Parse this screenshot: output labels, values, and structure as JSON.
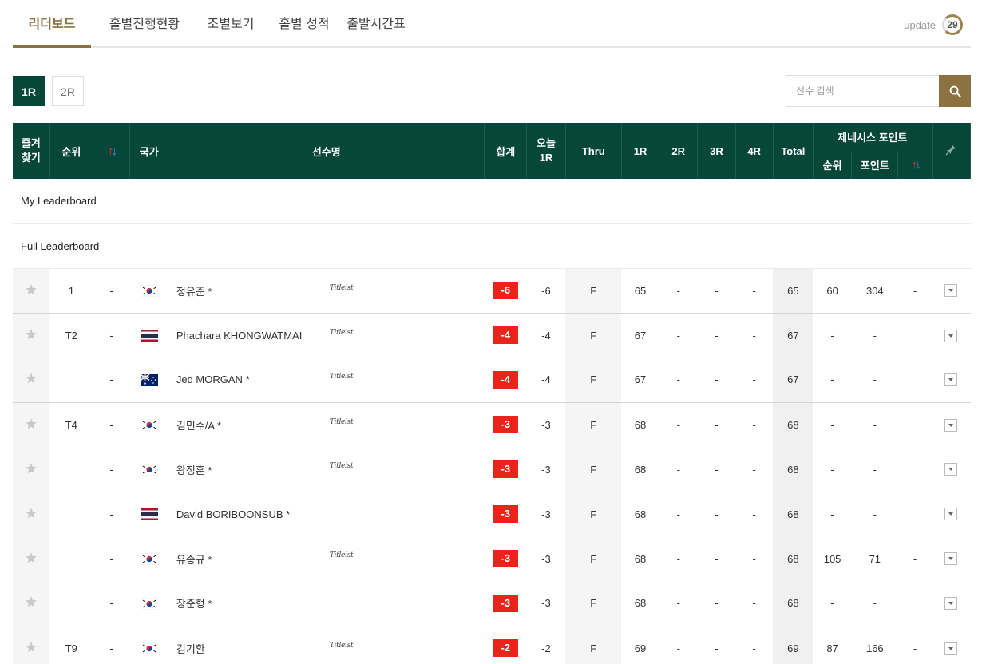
{
  "tabs": [
    "리더보드",
    "홀별진행현황",
    "조별보기",
    "홀별 성적",
    "출발시간표"
  ],
  "update": {
    "label": "update",
    "countdown": "29"
  },
  "rounds": [
    "1R",
    "2R"
  ],
  "search": {
    "placeholder": "선수 검색"
  },
  "headers": {
    "fav": "즐겨찾기",
    "rank": "순위",
    "country": "국가",
    "player": "선수명",
    "sum": "합계",
    "today": "오늘 1R",
    "thru": "Thru",
    "r1": "1R",
    "r2": "2R",
    "r3": "3R",
    "r4": "4R",
    "total": "Total",
    "genesis": "제네시스 포인트",
    "g_rank": "순위",
    "g_point": "포인트"
  },
  "sections": {
    "my": "My Leaderboard",
    "full": "Full Leaderboard"
  },
  "rows": [
    {
      "pos": "1",
      "move": "-",
      "flag": "kr",
      "name": "정유준",
      "star": "*",
      "logo": "Titleist",
      "sum": "-6",
      "today": "-6",
      "thru": "F",
      "r1": "65",
      "r2": "-",
      "r3": "-",
      "r4": "-",
      "total": "65",
      "g_rank": "60",
      "g_point": "304",
      "g_move": "-"
    },
    {
      "pos": "T2",
      "move": "-",
      "flag": "th",
      "name": "Phachara KHONGWATMAI",
      "star": "",
      "logo": "Titleist",
      "sum": "-4",
      "today": "-4",
      "thru": "F",
      "r1": "67",
      "r2": "-",
      "r3": "-",
      "r4": "-",
      "total": "67",
      "g_rank": "-",
      "g_point": "-",
      "g_move": ""
    },
    {
      "pos": "",
      "move": "-",
      "flag": "au",
      "name": "Jed MORGAN",
      "star": "*",
      "logo": "Titleist",
      "sum": "-4",
      "today": "-4",
      "thru": "F",
      "r1": "67",
      "r2": "-",
      "r3": "-",
      "r4": "-",
      "total": "67",
      "g_rank": "-",
      "g_point": "-",
      "g_move": ""
    },
    {
      "pos": "T4",
      "move": "-",
      "flag": "kr",
      "name": "김민수/A",
      "star": "*",
      "logo": "Titleist",
      "sum": "-3",
      "today": "-3",
      "thru": "F",
      "r1": "68",
      "r2": "-",
      "r3": "-",
      "r4": "-",
      "total": "68",
      "g_rank": "-",
      "g_point": "-",
      "g_move": ""
    },
    {
      "pos": "",
      "move": "-",
      "flag": "kr",
      "name": "왕정훈",
      "star": "*",
      "logo": "Titleist",
      "sum": "-3",
      "today": "-3",
      "thru": "F",
      "r1": "68",
      "r2": "-",
      "r3": "-",
      "r4": "-",
      "total": "68",
      "g_rank": "-",
      "g_point": "-",
      "g_move": ""
    },
    {
      "pos": "",
      "move": "-",
      "flag": "th",
      "name": "David BORIBOONSUB",
      "star": "*",
      "logo": "",
      "sum": "-3",
      "today": "-3",
      "thru": "F",
      "r1": "68",
      "r2": "-",
      "r3": "-",
      "r4": "-",
      "total": "68",
      "g_rank": "-",
      "g_point": "-",
      "g_move": ""
    },
    {
      "pos": "",
      "move": "-",
      "flag": "kr",
      "name": "유송규",
      "star": "*",
      "logo": "Titleist",
      "sum": "-3",
      "today": "-3",
      "thru": "F",
      "r1": "68",
      "r2": "-",
      "r3": "-",
      "r4": "-",
      "total": "68",
      "g_rank": "105",
      "g_point": "71",
      "g_move": "-"
    },
    {
      "pos": "",
      "move": "-",
      "flag": "kr",
      "name": "장준형",
      "star": "*",
      "logo": "",
      "sum": "-3",
      "today": "-3",
      "thru": "F",
      "r1": "68",
      "r2": "-",
      "r3": "-",
      "r4": "-",
      "total": "68",
      "g_rank": "-",
      "g_point": "-",
      "g_move": ""
    },
    {
      "pos": "T9",
      "move": "-",
      "flag": "kr",
      "name": "김기환",
      "star": "",
      "logo": "Titleist",
      "sum": "-2",
      "today": "-2",
      "thru": "F",
      "r1": "69",
      "r2": "-",
      "r3": "-",
      "r4": "-",
      "total": "69",
      "g_rank": "87",
      "g_point": "166",
      "g_move": "-"
    }
  ],
  "colors": {
    "primary": "#06473a",
    "gold": "#8b7240",
    "score_red": "#e8241b"
  }
}
